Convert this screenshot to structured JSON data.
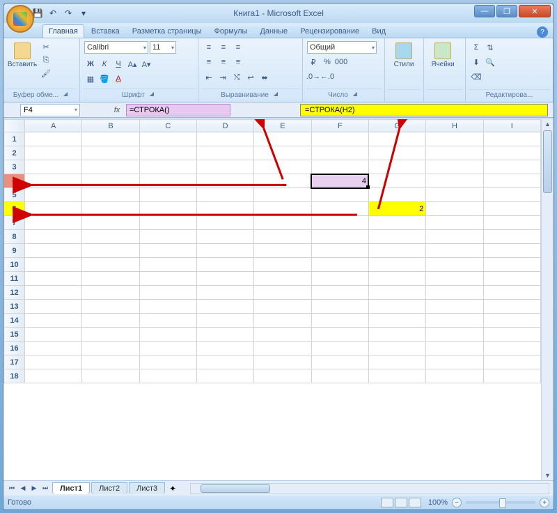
{
  "window": {
    "title": "Книга1 - Microsoft Excel"
  },
  "qat": {
    "save": "💾",
    "undo": "↶",
    "redo": "↷"
  },
  "tabs": {
    "home": "Главная",
    "insert": "Вставка",
    "layout": "Разметка страницы",
    "formulas": "Формулы",
    "data": "Данные",
    "review": "Рецензирование",
    "view": "Вид"
  },
  "ribbon": {
    "clipboard": {
      "paste": "Вставить",
      "label": "Буфер обме..."
    },
    "font": {
      "name": "Calibri",
      "size": "11",
      "label": "Шрифт"
    },
    "align": {
      "label": "Выравнивание"
    },
    "number": {
      "format": "Общий",
      "label": "Число"
    },
    "styles": {
      "btn": "Стили",
      "label": ""
    },
    "cells": {
      "btn": "Ячейки",
      "label": ""
    },
    "editing": {
      "label": "Редактирова..."
    }
  },
  "namebox": "F4",
  "formula": "=СТРОКА()",
  "annotation": "=СТРОКА(H2)",
  "columns": [
    "A",
    "B",
    "C",
    "D",
    "E",
    "F",
    "G",
    "H",
    "I"
  ],
  "rows_count": 18,
  "cells": {
    "F4": "4",
    "G6": "2"
  },
  "sheets": {
    "s1": "Лист1",
    "s2": "Лист2",
    "s3": "Лист3"
  },
  "status": {
    "ready": "Готово",
    "zoom": "100%"
  }
}
